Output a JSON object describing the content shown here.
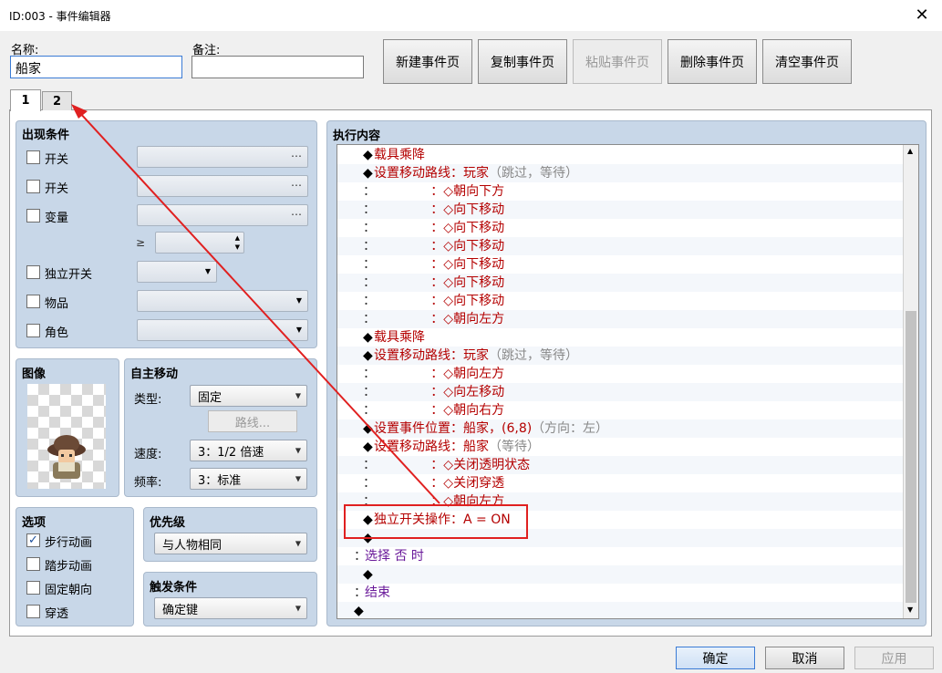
{
  "window": {
    "title": "ID:003 - 事件编辑器",
    "close_glyph": "✕"
  },
  "name": {
    "label": "名称:",
    "value": "船家"
  },
  "note": {
    "label": "备注:",
    "value": ""
  },
  "toolbar": {
    "new_page": "新建事件页",
    "copy_page": "复制事件页",
    "paste_page": "粘贴事件页",
    "delete_page": "删除事件页",
    "clear_page": "清空事件页"
  },
  "tabs": [
    {
      "label": "1"
    },
    {
      "label": "2"
    }
  ],
  "conditions": {
    "title": "出现条件",
    "switch1": "开关",
    "switch2": "开关",
    "variable": "变量",
    "gte": "≥",
    "self_switch": "独立开关",
    "item": "物品",
    "actor": "角色",
    "dots": "…"
  },
  "image": {
    "title": "图像"
  },
  "autonomous": {
    "title": "自主移动",
    "type_label": "类型:",
    "type_value": "固定",
    "route_button": "路线...",
    "speed_label": "速度:",
    "speed_value": "3：1/2 倍速",
    "freq_label": "频率:",
    "freq_value": "3：标准"
  },
  "options": {
    "title": "选项",
    "walking": "步行动画",
    "stepping": "踏步动画",
    "direction_fix": "固定朝向",
    "through": "穿透"
  },
  "priority": {
    "title": "优先级",
    "value": "与人物相同"
  },
  "trigger": {
    "title": "触发条件",
    "value": "确定键"
  },
  "contents": {
    "title": "执行内容",
    "lines": [
      {
        "indent": "",
        "bullet": "◆",
        "text": "载具乘降",
        "detail": "",
        "color": "red"
      },
      {
        "indent": "",
        "bullet": "◆",
        "text": "设置移动路线：玩家",
        "detail": "（跳过，等待）",
        "color": "red"
      },
      {
        "indent": "",
        "bullet": "：",
        "text": "              ：◇朝向下方",
        "detail": "",
        "color": "red"
      },
      {
        "indent": "",
        "bullet": "：",
        "text": "              ：◇向下移动",
        "detail": "",
        "color": "red"
      },
      {
        "indent": "",
        "bullet": "：",
        "text": "              ：◇向下移动",
        "detail": "",
        "color": "red"
      },
      {
        "indent": "",
        "bullet": "：",
        "text": "              ：◇向下移动",
        "detail": "",
        "color": "red"
      },
      {
        "indent": "",
        "bullet": "：",
        "text": "              ：◇向下移动",
        "detail": "",
        "color": "red"
      },
      {
        "indent": "",
        "bullet": "：",
        "text": "              ：◇向下移动",
        "detail": "",
        "color": "red"
      },
      {
        "indent": "",
        "bullet": "：",
        "text": "              ：◇向下移动",
        "detail": "",
        "color": "red"
      },
      {
        "indent": "",
        "bullet": "：",
        "text": "              ：◇朝向左方",
        "detail": "",
        "color": "red"
      },
      {
        "indent": "",
        "bullet": "◆",
        "text": "载具乘降",
        "detail": "",
        "color": "red"
      },
      {
        "indent": "",
        "bullet": "◆",
        "text": "设置移动路线：玩家",
        "detail": "（跳过，等待）",
        "color": "red"
      },
      {
        "indent": "",
        "bullet": "：",
        "text": "              ：◇朝向左方",
        "detail": "",
        "color": "red"
      },
      {
        "indent": "",
        "bullet": "：",
        "text": "              ：◇向左移动",
        "detail": "",
        "color": "red"
      },
      {
        "indent": "",
        "bullet": "：",
        "text": "              ：◇朝向右方",
        "detail": "",
        "color": "red"
      },
      {
        "indent": "",
        "bullet": "◆",
        "text": "设置事件位置：船家，(6,8)",
        "detail": "（方向：左）",
        "color": "red"
      },
      {
        "indent": "",
        "bullet": "◆",
        "text": "设置移动路线：船家",
        "detail": "（等待）",
        "color": "red"
      },
      {
        "indent": "",
        "bullet": "：",
        "text": "              ：◇关闭透明状态",
        "detail": "",
        "color": "red"
      },
      {
        "indent": "",
        "bullet": "：",
        "text": "              ：◇关闭穿透",
        "detail": "",
        "color": "red"
      },
      {
        "indent": "",
        "bullet": "：",
        "text": "              ：◇朝向左方",
        "detail": "",
        "color": "red"
      },
      {
        "indent": "",
        "bullet": "◆",
        "text": "独立开关操作：A = ON",
        "detail": "",
        "color": "red"
      },
      {
        "indent": "",
        "bullet": "◆",
        "text": "",
        "detail": "",
        "color": "black"
      },
      {
        "indent": "outer",
        "bullet": "：",
        "text": "选择 否 时",
        "detail": "",
        "color": "purple"
      },
      {
        "indent": "",
        "bullet": "◆",
        "text": "",
        "detail": "",
        "color": "black"
      },
      {
        "indent": "outer",
        "bullet": "：",
        "text": "结束",
        "detail": "",
        "color": "purple"
      },
      {
        "indent": "outer",
        "bullet": "◆",
        "text": "",
        "detail": "",
        "color": "black"
      }
    ]
  },
  "footer": {
    "ok": "确定",
    "cancel": "取消",
    "apply": "应用"
  },
  "annotation": {
    "color": "#e02020"
  }
}
